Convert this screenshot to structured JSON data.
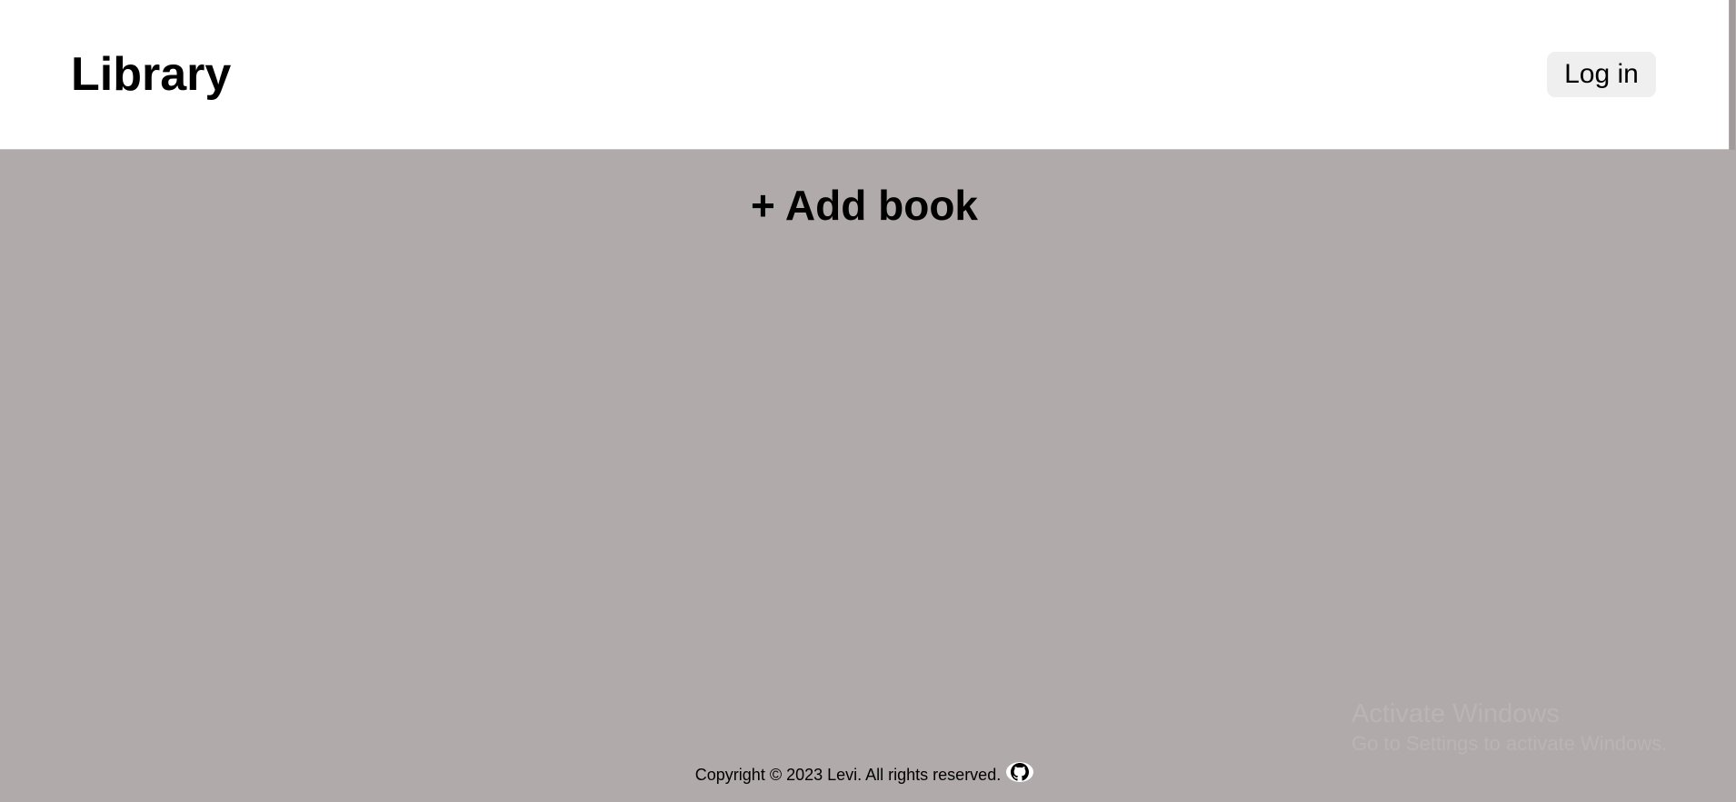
{
  "header": {
    "title": "Library",
    "login_label": "Log in"
  },
  "main": {
    "add_book_label": "+ Add book"
  },
  "footer": {
    "copyright": "Copyright © 2023 Levi. All rights reserved.",
    "github_icon": "github-icon"
  },
  "watermark": {
    "title": "Activate Windows",
    "subtitle": "Go to Settings to activate Windows."
  },
  "colors": {
    "background": "#b0aaaa",
    "header_background": "#ffffff",
    "button_background": "#efefef"
  }
}
